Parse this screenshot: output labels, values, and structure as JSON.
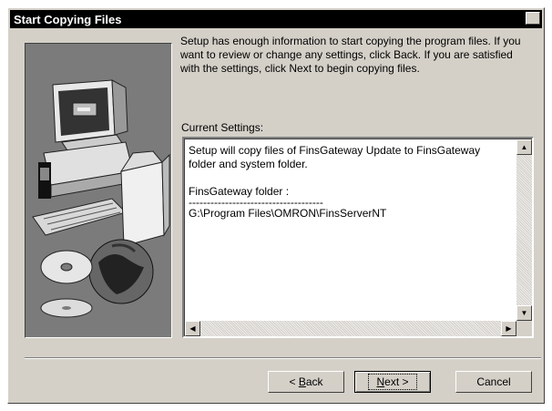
{
  "dialog": {
    "title": "Start Copying Files",
    "close_symbol": "✕"
  },
  "intro_text": "Setup has enough information to start copying the program files. If you want to review or change any settings, click Back.  If you are satisfied with the settings, click Next to begin copying files.",
  "current_settings": {
    "label": "Current Settings:",
    "lines": [
      "Setup will copy files of FinsGateway Update to FinsGateway folder and system folder.",
      "FinsGateway folder :",
      "-------------------------------------",
      "G:\\Program Files\\OMRON\\FinsServerNT"
    ]
  },
  "buttons": {
    "back_prefix": "< ",
    "back_underlined": "B",
    "back_rest": "ack",
    "next_underlined": "N",
    "next_rest": "ext >",
    "cancel": "Cancel"
  },
  "icons": {
    "scroll_up": "▲",
    "scroll_down": "▼",
    "scroll_left": "◀",
    "scroll_right": "▶"
  }
}
